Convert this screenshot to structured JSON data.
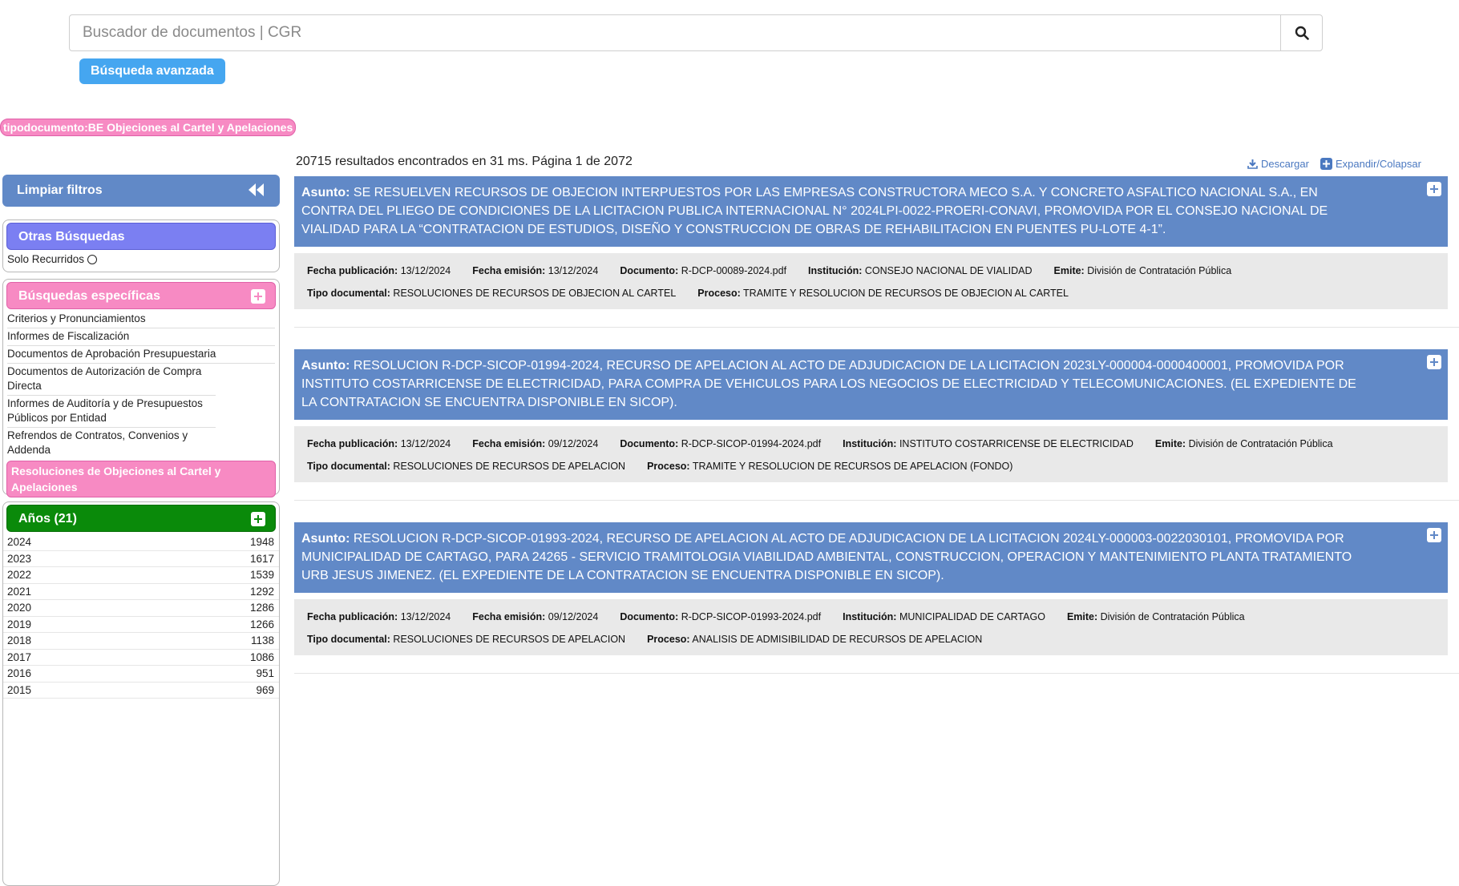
{
  "search": {
    "placeholder": "Buscador de documentos | CGR",
    "advanced_label": "Búsqueda avanzada",
    "active_filter": "tipodocumento:BE Objeciones al Cartel y Apelaciones"
  },
  "sidebar": {
    "clear_label": "Limpiar filtros",
    "otras": {
      "title": "Otras Búsquedas",
      "item": "Solo Recurridos"
    },
    "especificas": {
      "title": "Búsquedas específicas",
      "items": [
        "Criterios y Pronunciamientos",
        "Informes de Fiscalización",
        "Documentos de Aprobación Presupuestaria",
        "Documentos de Autorización de Compra Directa",
        "Informes de Auditoría y de Presupuestos Públicos por Entidad",
        "Refrendos de Contratos, Convenios y Addenda"
      ],
      "selected": "Resoluciones de Objeciones al Cartel y Apelaciones"
    },
    "anios": {
      "title": "Años (21)",
      "rows": [
        {
          "year": "2024",
          "count": "1948"
        },
        {
          "year": "2023",
          "count": "1617"
        },
        {
          "year": "2022",
          "count": "1539"
        },
        {
          "year": "2021",
          "count": "1292"
        },
        {
          "year": "2020",
          "count": "1286"
        },
        {
          "year": "2019",
          "count": "1266"
        },
        {
          "year": "2018",
          "count": "1138"
        },
        {
          "year": "2017",
          "count": "1086"
        },
        {
          "year": "2016",
          "count": "951"
        },
        {
          "year": "2015",
          "count": "969"
        }
      ]
    }
  },
  "results": {
    "summary": "20715 resultados encontrados en 31 ms. Página 1 de 2072",
    "download_label": "Descargar",
    "expand_label": "Expandir/Colapsar",
    "labels": {
      "asunto": "Asunto:",
      "fecha_pub": "Fecha publicación:",
      "fecha_emi": "Fecha emisión:",
      "documento": "Documento:",
      "institucion": "Institución:",
      "emite": "Emite:",
      "tipo": "Tipo documental:",
      "proceso": "Proceso:"
    },
    "items": [
      {
        "asunto": "SE RESUELVEN RECURSOS DE OBJECION INTERPUESTOS POR LAS EMPRESAS CONSTRUCTORA MECO S.A. Y CONCRETO ASFALTICO NACIONAL S.A., EN CONTRA DEL PLIEGO DE CONDICIONES DE LA LICITACION PUBLICA INTERNACIONAL N° 2024LPI-0022-PROERI-CONAVI, PROMOVIDA POR EL CONSEJO NACIONAL DE VIALIDAD PARA LA “CONTRATACION DE ESTUDIOS, DISEÑO Y CONSTRUCCION DE OBRAS DE REHABILITACION EN PUENTES PU-LOTE 4-1”.",
        "fecha_pub": "13/12/2024",
        "fecha_emi": "13/12/2024",
        "documento": "R-DCP-00089-2024.pdf",
        "institucion": "CONSEJO NACIONAL DE VIALIDAD",
        "emite": "División de Contratación Pública",
        "tipo": "RESOLUCIONES DE RECURSOS DE OBJECION AL CARTEL",
        "proceso": "TRAMITE Y RESOLUCION DE RECURSOS DE OBJECION AL CARTEL"
      },
      {
        "asunto": "RESOLUCION R-DCP-SICOP-01994-2024, RECURSO DE APELACION AL ACTO DE ADJUDICACION DE LA LICITACION 2023LY-000004-0000400001, PROMOVIDA POR INSTITUTO COSTARRICENSE DE ELECTRICIDAD, PARA COMPRA DE VEHICULOS PARA LOS NEGOCIOS DE ELECTRICIDAD Y TELECOMUNICACIONES. (EL EXPEDIENTE DE LA CONTRATACION SE ENCUENTRA DISPONIBLE EN SICOP).",
        "fecha_pub": "13/12/2024",
        "fecha_emi": "09/12/2024",
        "documento": "R-DCP-SICOP-01994-2024.pdf",
        "institucion": "INSTITUTO COSTARRICENSE DE ELECTRICIDAD",
        "emite": "División de Contratación Pública",
        "tipo": "RESOLUCIONES DE RECURSOS DE APELACION",
        "proceso": "TRAMITE Y RESOLUCION DE RECURSOS DE APELACION (FONDO)"
      },
      {
        "asunto": "RESOLUCION R-DCP-SICOP-01993-2024, RECURSO DE APELACION AL ACTO DE ADJUDICACION DE LA LICITACION 2024LY-000003-0022030101, PROMOVIDA POR MUNICIPALIDAD DE CARTAGO, PARA 24265 - SERVICIO TRAMITOLOGIA VIABILIDAD AMBIENTAL, CONSTRUCCION, OPERACION Y MANTENIMIENTO PLANTA TRATAMIENTO URB JESUS JIMENEZ. (EL EXPEDIENTE DE LA CONTRATACION SE ENCUENTRA DISPONIBLE EN SICOP).",
        "fecha_pub": "13/12/2024",
        "fecha_emi": "09/12/2024",
        "documento": "R-DCP-SICOP-01993-2024.pdf",
        "institucion": "MUNICIPALIDAD DE CARTAGO",
        "emite": "División de Contratación Pública",
        "tipo": "RESOLUCIONES DE RECURSOS DE APELACION",
        "proceso": "ANALISIS DE ADMISIBILIDAD DE RECURSOS DE APELACION"
      }
    ]
  },
  "colors": {
    "primary_blue": "#6189c7",
    "button_blue": "#45a6f0",
    "pink": "#f78ac3",
    "purple": "#7b7ff2",
    "green": "#0a8a0a"
  }
}
